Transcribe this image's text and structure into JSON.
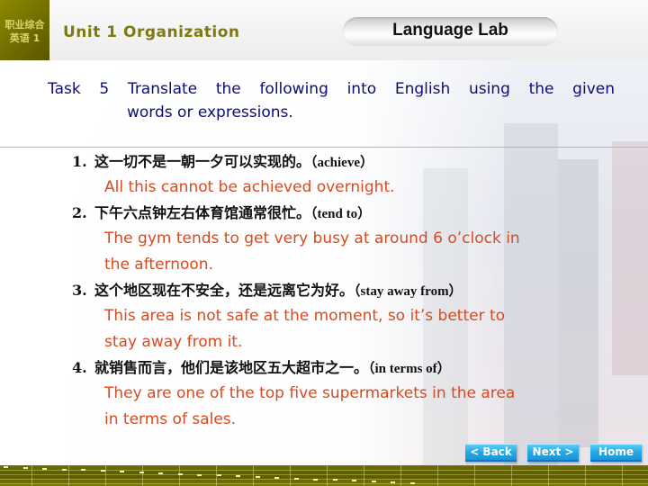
{
  "header": {
    "logo_line1": "职业综合",
    "logo_line2": "英语 1",
    "unit_title": "Unit 1  Organization",
    "section_title": "Language Lab"
  },
  "task": {
    "line1": "Task 5 Translate the following into English using the given",
    "line2": "words or expressions."
  },
  "items": [
    {
      "num": "1.",
      "chinese": "这一切不是一朝一夕可以实现的。",
      "hint": "（achieve）",
      "english": [
        "All this cannot be achieved overnight."
      ]
    },
    {
      "num": "2.",
      "chinese": "下午六点钟左右体育馆通常很忙。",
      "hint": "（tend to）",
      "english": [
        "The gym tends to get very busy at around 6 o’clock in",
        "the afternoon."
      ]
    },
    {
      "num": "3.",
      "chinese": "这个地区现在不安全，还是远离它为好。",
      "hint": "（stay away from）",
      "english": [
        "This area is not safe at the moment, so it’s better to",
        "stay away from it."
      ]
    },
    {
      "num": "4.",
      "chinese": "就销售而言，他们是该地区五大超市之一。",
      "hint": "（in terms of）",
      "english": [
        "They are one of the top five supermarkets in the area",
        "in terms of sales."
      ]
    }
  ],
  "nav": {
    "back": "< Back",
    "next": "Next >",
    "home": "Home"
  },
  "colors": {
    "brand_olive": "#7d7a10",
    "task_text": "#0d0d78",
    "answer_text": "#d94a1e",
    "nav_button": "#26a8e6"
  }
}
